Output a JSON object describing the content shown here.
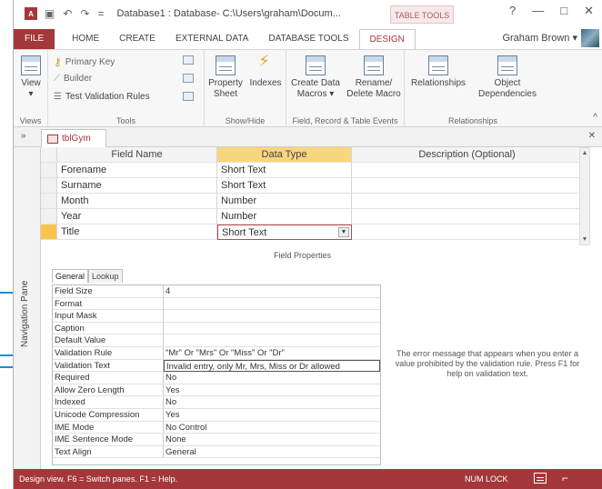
{
  "titlebar": {
    "app_icon": "A",
    "qat_icons": [
      "save-icon",
      "undo-icon",
      "redo-icon",
      "customize-icon"
    ],
    "title": "Database1 : Database- C:\\Users\\graham\\Docum...",
    "contextual_label": "TABLE TOOLS",
    "controls": [
      "?",
      "—",
      "□",
      "✕"
    ]
  },
  "tabs": {
    "items": [
      "FILE",
      "HOME",
      "CREATE",
      "EXTERNAL DATA",
      "DATABASE TOOLS",
      "DESIGN"
    ],
    "active": "DESIGN",
    "user": "Graham Brown ▾"
  },
  "ribbon": {
    "views": {
      "view": "View",
      "group": "Views"
    },
    "tools": {
      "primary_key": "Primary Key",
      "builder": "Builder",
      "test_validation": "Test Validation Rules",
      "group": "Tools"
    },
    "show_hide": {
      "property_sheet": [
        "Property",
        "Sheet"
      ],
      "indexes": "Indexes",
      "group": "Show/Hide"
    },
    "field_events": {
      "create_data_macros": [
        "Create Data",
        "Macros ▾"
      ],
      "rename_delete_macro": [
        "Rename/",
        "Delete Macro"
      ],
      "group": "Field, Record & Table Events"
    },
    "relationships": {
      "relationships": "Relationships",
      "object_dependencies": [
        "Object",
        "Dependencies"
      ],
      "group": "Relationships"
    }
  },
  "document": {
    "nav_toggle": "»",
    "tab_name": "tblGym",
    "close": "✕",
    "nav_pane_label": "Navigation Pane"
  },
  "grid": {
    "headers": [
      "Field Name",
      "Data Type",
      "Description (Optional)"
    ],
    "rows": [
      {
        "field": "Forename",
        "type": "Short Text"
      },
      {
        "field": "Surname",
        "type": "Short Text"
      },
      {
        "field": "Month",
        "type": "Number"
      },
      {
        "field": "Year",
        "type": "Number"
      },
      {
        "field": "Title",
        "type": "Short Text"
      }
    ]
  },
  "field_properties": {
    "title": "Field Properties",
    "tabs": [
      "General",
      "Lookup"
    ],
    "rows": [
      {
        "name": "Field Size",
        "value": "4"
      },
      {
        "name": "Format",
        "value": ""
      },
      {
        "name": "Input Mask",
        "value": ""
      },
      {
        "name": "Caption",
        "value": ""
      },
      {
        "name": "Default Value",
        "value": ""
      },
      {
        "name": "Validation Rule",
        "value": "\"Mr\" Or \"Mrs\" Or \"Miss\" Or \"Dr\""
      },
      {
        "name": "Validation Text",
        "value": "Invalid entry, only Mr, Mrs, Miss or Dr allowed"
      },
      {
        "name": "Required",
        "value": "No"
      },
      {
        "name": "Allow Zero Length",
        "value": "Yes"
      },
      {
        "name": "Indexed",
        "value": "No"
      },
      {
        "name": "Unicode Compression",
        "value": "Yes"
      },
      {
        "name": "IME Mode",
        "value": "No Control"
      },
      {
        "name": "IME Sentence Mode",
        "value": "None"
      },
      {
        "name": "Text Align",
        "value": "General"
      }
    ],
    "help": "The error message that appears when you enter a value prohibited by the validation rule. Press F1 for help on validation text."
  },
  "statusbar": {
    "left": "Design view.  F6 = Switch panes.  F1 = Help.",
    "num_lock": "NUM LOCK"
  },
  "colors": {
    "accent": "#a4373a",
    "callout": "#1a8fd1",
    "header_highlight": "#f8d67e"
  }
}
